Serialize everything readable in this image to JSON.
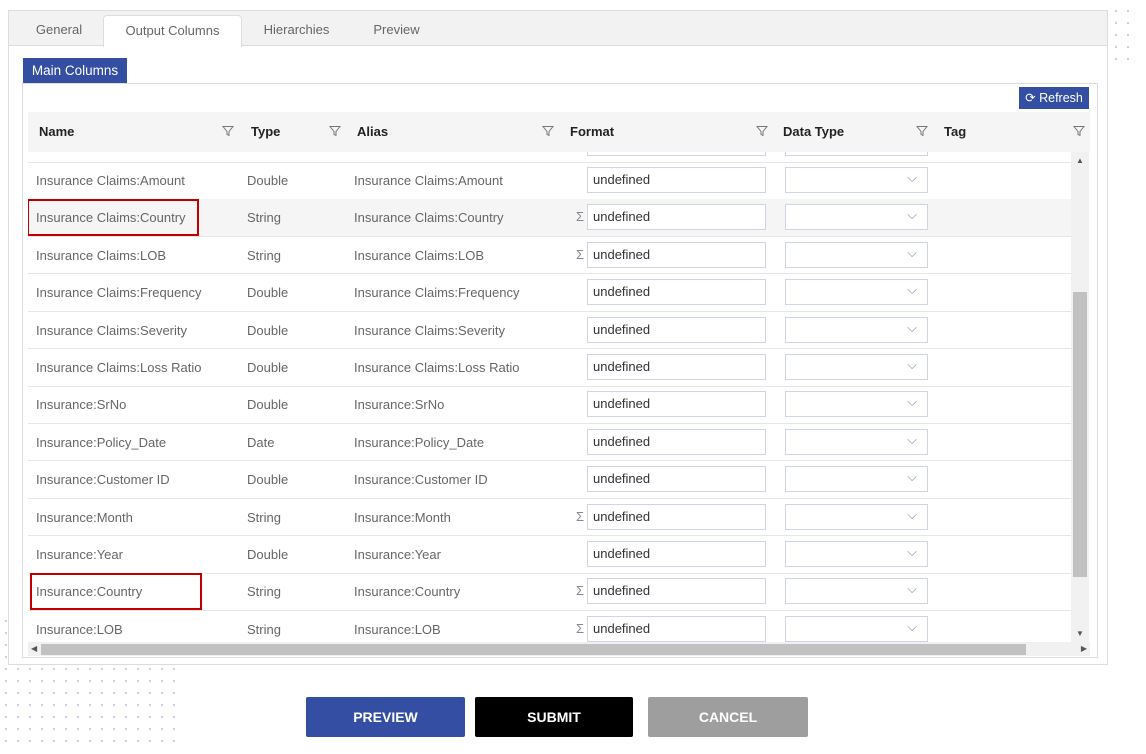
{
  "tabs": [
    {
      "label": "General"
    },
    {
      "label": "Output Columns",
      "active": true
    },
    {
      "label": "Hierarchies"
    },
    {
      "label": "Preview"
    }
  ],
  "subtab": "Main Columns",
  "refresh_label": "Refresh",
  "columns": [
    "Name",
    "Type",
    "Alias",
    "Format",
    "Data Type",
    "Tag"
  ],
  "rows": [
    {
      "name": "Insurance Claims:Amount",
      "type": "Double",
      "alias": "Insurance Claims:Amount",
      "format": "undefined",
      "sigma": false
    },
    {
      "name": "Insurance Claims:Country",
      "type": "String",
      "alias": "Insurance Claims:Country",
      "format": "undefined",
      "sigma": true,
      "highlighted": true,
      "marked": true
    },
    {
      "name": "Insurance Claims:LOB",
      "type": "String",
      "alias": "Insurance Claims:LOB",
      "format": "undefined",
      "sigma": true
    },
    {
      "name": "Insurance Claims:Frequency",
      "type": "Double",
      "alias": "Insurance Claims:Frequency",
      "format": "undefined",
      "sigma": false
    },
    {
      "name": "Insurance Claims:Severity",
      "type": "Double",
      "alias": "Insurance Claims:Severity",
      "format": "undefined",
      "sigma": false
    },
    {
      "name": "Insurance Claims:Loss Ratio",
      "type": "Double",
      "alias": "Insurance Claims:Loss Ratio",
      "format": "undefined",
      "sigma": false
    },
    {
      "name": "Insurance:SrNo",
      "type": "Double",
      "alias": "Insurance:SrNo",
      "format": "undefined",
      "sigma": false
    },
    {
      "name": "Insurance:Policy_Date",
      "type": "Date",
      "alias": "Insurance:Policy_Date",
      "format": "undefined",
      "sigma": false
    },
    {
      "name": "Insurance:Customer ID",
      "type": "Double",
      "alias": "Insurance:Customer ID",
      "format": "undefined",
      "sigma": false
    },
    {
      "name": "Insurance:Month",
      "type": "String",
      "alias": "Insurance:Month",
      "format": "undefined",
      "sigma": true
    },
    {
      "name": "Insurance:Year",
      "type": "Double",
      "alias": "Insurance:Year",
      "format": "undefined",
      "sigma": false
    },
    {
      "name": "Insurance:Country",
      "type": "String",
      "alias": "Insurance:Country",
      "format": "undefined",
      "sigma": true,
      "marked": true
    },
    {
      "name": "Insurance:LOB",
      "type": "String",
      "alias": "Insurance:LOB",
      "format": "undefined",
      "sigma": true
    }
  ],
  "sigma_symbol": "Σ",
  "buttons": {
    "preview": "PREVIEW",
    "submit": "SUBMIT",
    "cancel": "CANCEL"
  },
  "colors": {
    "primary": "#334ea3",
    "submit": "#000000",
    "cancel": "#9e9e9e",
    "marker": "#c00000"
  }
}
